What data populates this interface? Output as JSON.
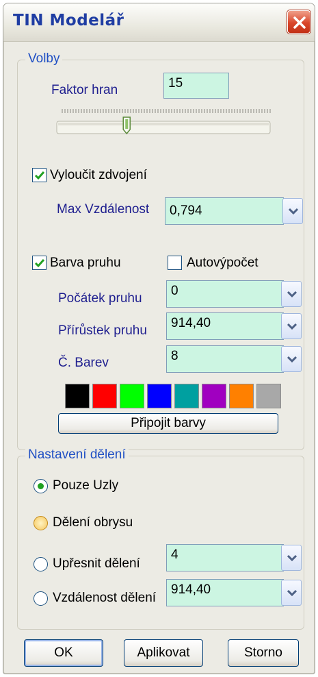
{
  "window": {
    "title": "TIN Modelář"
  },
  "volby": {
    "group_label": "Volby",
    "faktor_hran_label": "Faktor hran",
    "faktor_hran_value": "15",
    "slider_fraction": 0.31,
    "vyloucit_zdvojeni_label": "Vyloučit zdvojení",
    "vyloucit_zdvojeni_checked": true,
    "max_vzdalenost_label": "Max Vzdálenost",
    "max_vzdalenost_value": "0,794",
    "barva_pruhu_label": "Barva pruhu",
    "barva_pruhu_checked": true,
    "autovypocet_label": "Autovýpočet",
    "autovypocet_checked": false,
    "pocatek_pruhu_label": "Počátek pruhu",
    "pocatek_pruhu_value": "0",
    "prirustek_pruhu_label": "Přírůstek pruhu",
    "prirustek_pruhu_value": "914,40",
    "c_barev_label": "Č. Barev",
    "c_barev_value": "8",
    "colors": [
      "#000000",
      "#ff0000",
      "#00ff00",
      "#0000ff",
      "#00a0a0",
      "#a000c0",
      "#ff8000",
      "#a8a8a8"
    ],
    "pripojit_barvy_label": "Připojit barvy"
  },
  "deleni": {
    "group_label": "Nastavení dělení",
    "pouze_uzly_label": "Pouze Uzly",
    "deleni_obrysu_label": "Dělení obrysu",
    "upresnit_deleni_label": "Upřesnit dělení",
    "upresnit_deleni_value": "4",
    "vzdalenost_deleni_label": "Vzdálenost dělení",
    "vzdalenost_deleni_value": "914,40",
    "selected": "Pouze Uzly"
  },
  "buttons": {
    "ok": "OK",
    "aplikovat": "Aplikovat",
    "storno": "Storno"
  }
}
